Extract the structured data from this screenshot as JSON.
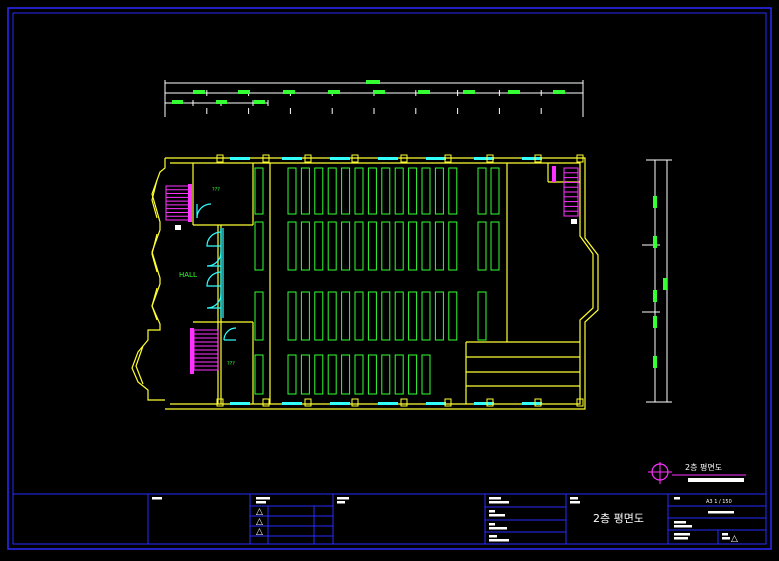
{
  "drawing": {
    "title": "2층 평면도",
    "legend_title": "2층 평면도",
    "hall_label": "HALL",
    "room_label": "???",
    "room_label_2": "???",
    "scale_text": "A3  1 / 150",
    "revision_marks": [
      "△",
      "△",
      "△"
    ],
    "title_block_triangle": "△"
  },
  "colors": {
    "background": "#000000",
    "frame": "#2a2aff",
    "wall": "#ffff33",
    "seat": "#33ff33",
    "stair": "#ff33ff",
    "door": "#33ffff",
    "dim": "#ffffff",
    "legend_circle": "#ff33ff"
  }
}
